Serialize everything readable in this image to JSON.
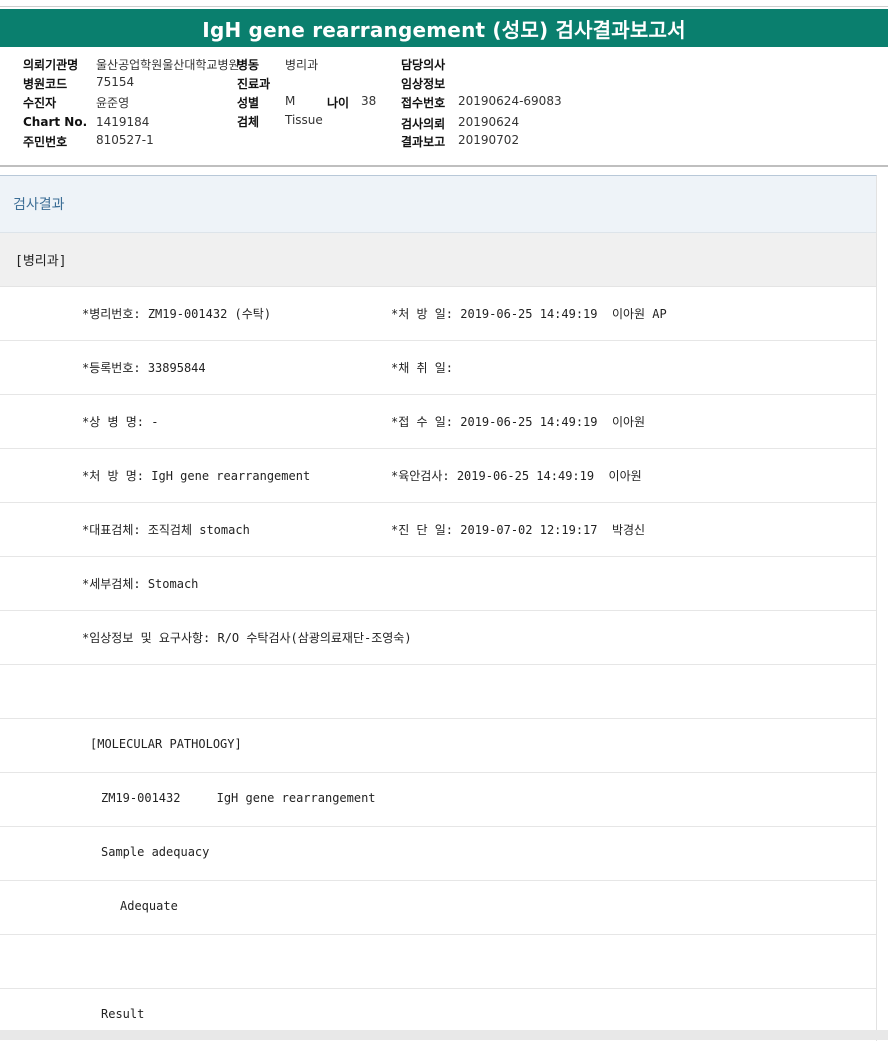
{
  "report": {
    "title": "IgH gene rearrangement (성모) 검사결과보고서"
  },
  "patient_info": {
    "institution_label": "의뢰기관명",
    "institution_value": "울산공업학원울산대학교병원",
    "ward_label": "병동",
    "ward_value": "병리과",
    "doctor_label": "담당의사",
    "doctor_value": "",
    "hospital_code_label": "병원코드",
    "hospital_code_value": "75154",
    "dept_label": "진료과",
    "dept_value": "",
    "clinical_label": "임상정보",
    "clinical_value": "",
    "patient_label": "수진자",
    "patient_value": "윤준영",
    "sex_label": "성별",
    "sex_value": "M",
    "age_label": "나이",
    "age_value": "38",
    "receipt_no_label": "접수번호",
    "receipt_no_value": "20190624-69083",
    "chart_label": "Chart No.",
    "chart_value": "1419184",
    "specimen_label": "검체",
    "specimen_value": "Tissue",
    "request_label": "검사의뢰",
    "request_value": "20190624",
    "id_label": "주민번호",
    "id_value": "810527-1",
    "report_label": "결과보고",
    "report_value": "20190702"
  },
  "results": {
    "heading": "검사결과",
    "section": "[병리과]",
    "rows": [
      {
        "left": "*병리번호: ZM19-001432 (수탁)",
        "right": "*처 방 일: 2019-06-25 14:49:19  이아원 AP"
      },
      {
        "left": "*등록번호: 33895844",
        "right": "*채 취 일:"
      },
      {
        "left": "*상 병 명: -",
        "right": "*접 수 일: 2019-06-25 14:49:19  이아원"
      },
      {
        "left": "*처 방 명: IgH gene rearrangement",
        "right": "*육안검사: 2019-06-25 14:49:19  이아원"
      },
      {
        "left": "*대표검체: 조직검체 stomach",
        "right": "*진 단 일: 2019-07-02 12:19:17  박경신"
      },
      {
        "left": "*세부검체: Stomach",
        "right": ""
      },
      {
        "left": "*임상정보 및 요구사항: R/O 수탁검사(삼광의료재단-조영숙)",
        "right": ""
      }
    ],
    "molecular_header": "[MOLECULAR PATHOLOGY]",
    "molecular_line": "ZM19-001432     IgH gene rearrangement",
    "adequacy_label": "Sample adequacy",
    "adequacy_value": "Adequate",
    "result_label": "Result"
  }
}
